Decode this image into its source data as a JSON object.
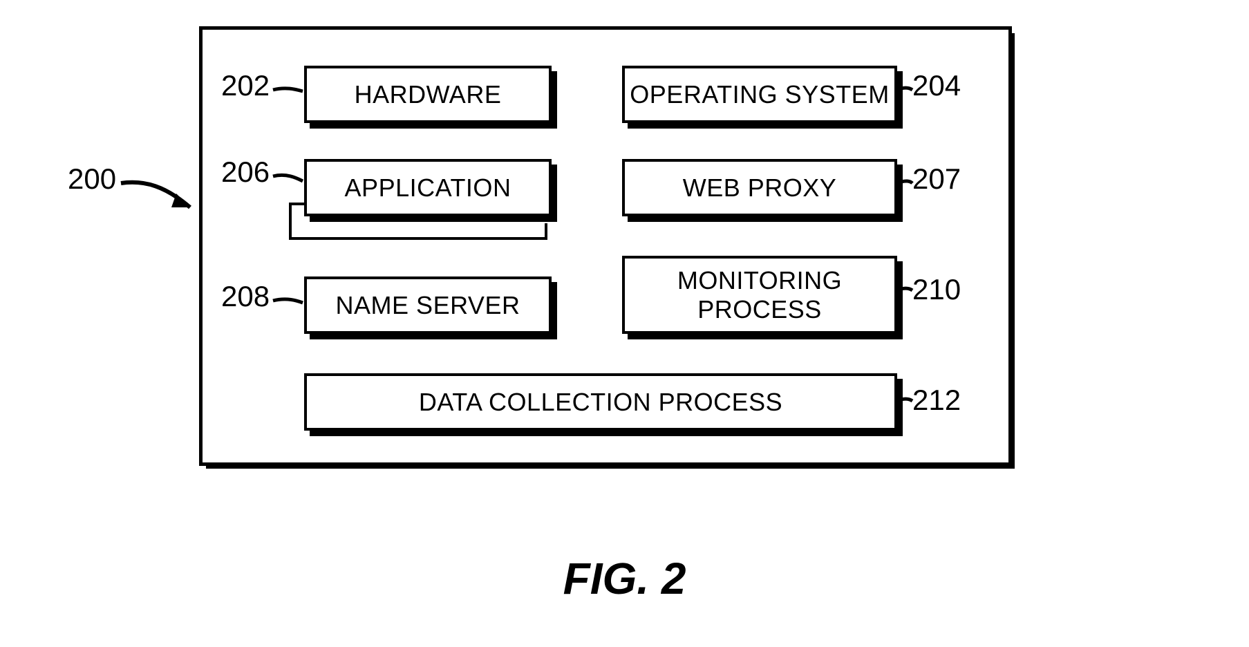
{
  "figure": {
    "caption": "FIG. 2",
    "ref_main": "200",
    "boxes": {
      "hardware": {
        "label": "HARDWARE",
        "ref": "202"
      },
      "os": {
        "label": "OPERATING SYSTEM",
        "ref": "204"
      },
      "application": {
        "label": "APPLICATION",
        "ref": "206"
      },
      "webproxy": {
        "label": "WEB PROXY",
        "ref": "207"
      },
      "nameserver": {
        "label": "NAME SERVER",
        "ref": "208"
      },
      "monitoring": {
        "label": "MONITORING PROCESS",
        "ref": "210"
      },
      "datacoll": {
        "label": "DATA COLLECTION PROCESS",
        "ref": "212"
      }
    }
  }
}
